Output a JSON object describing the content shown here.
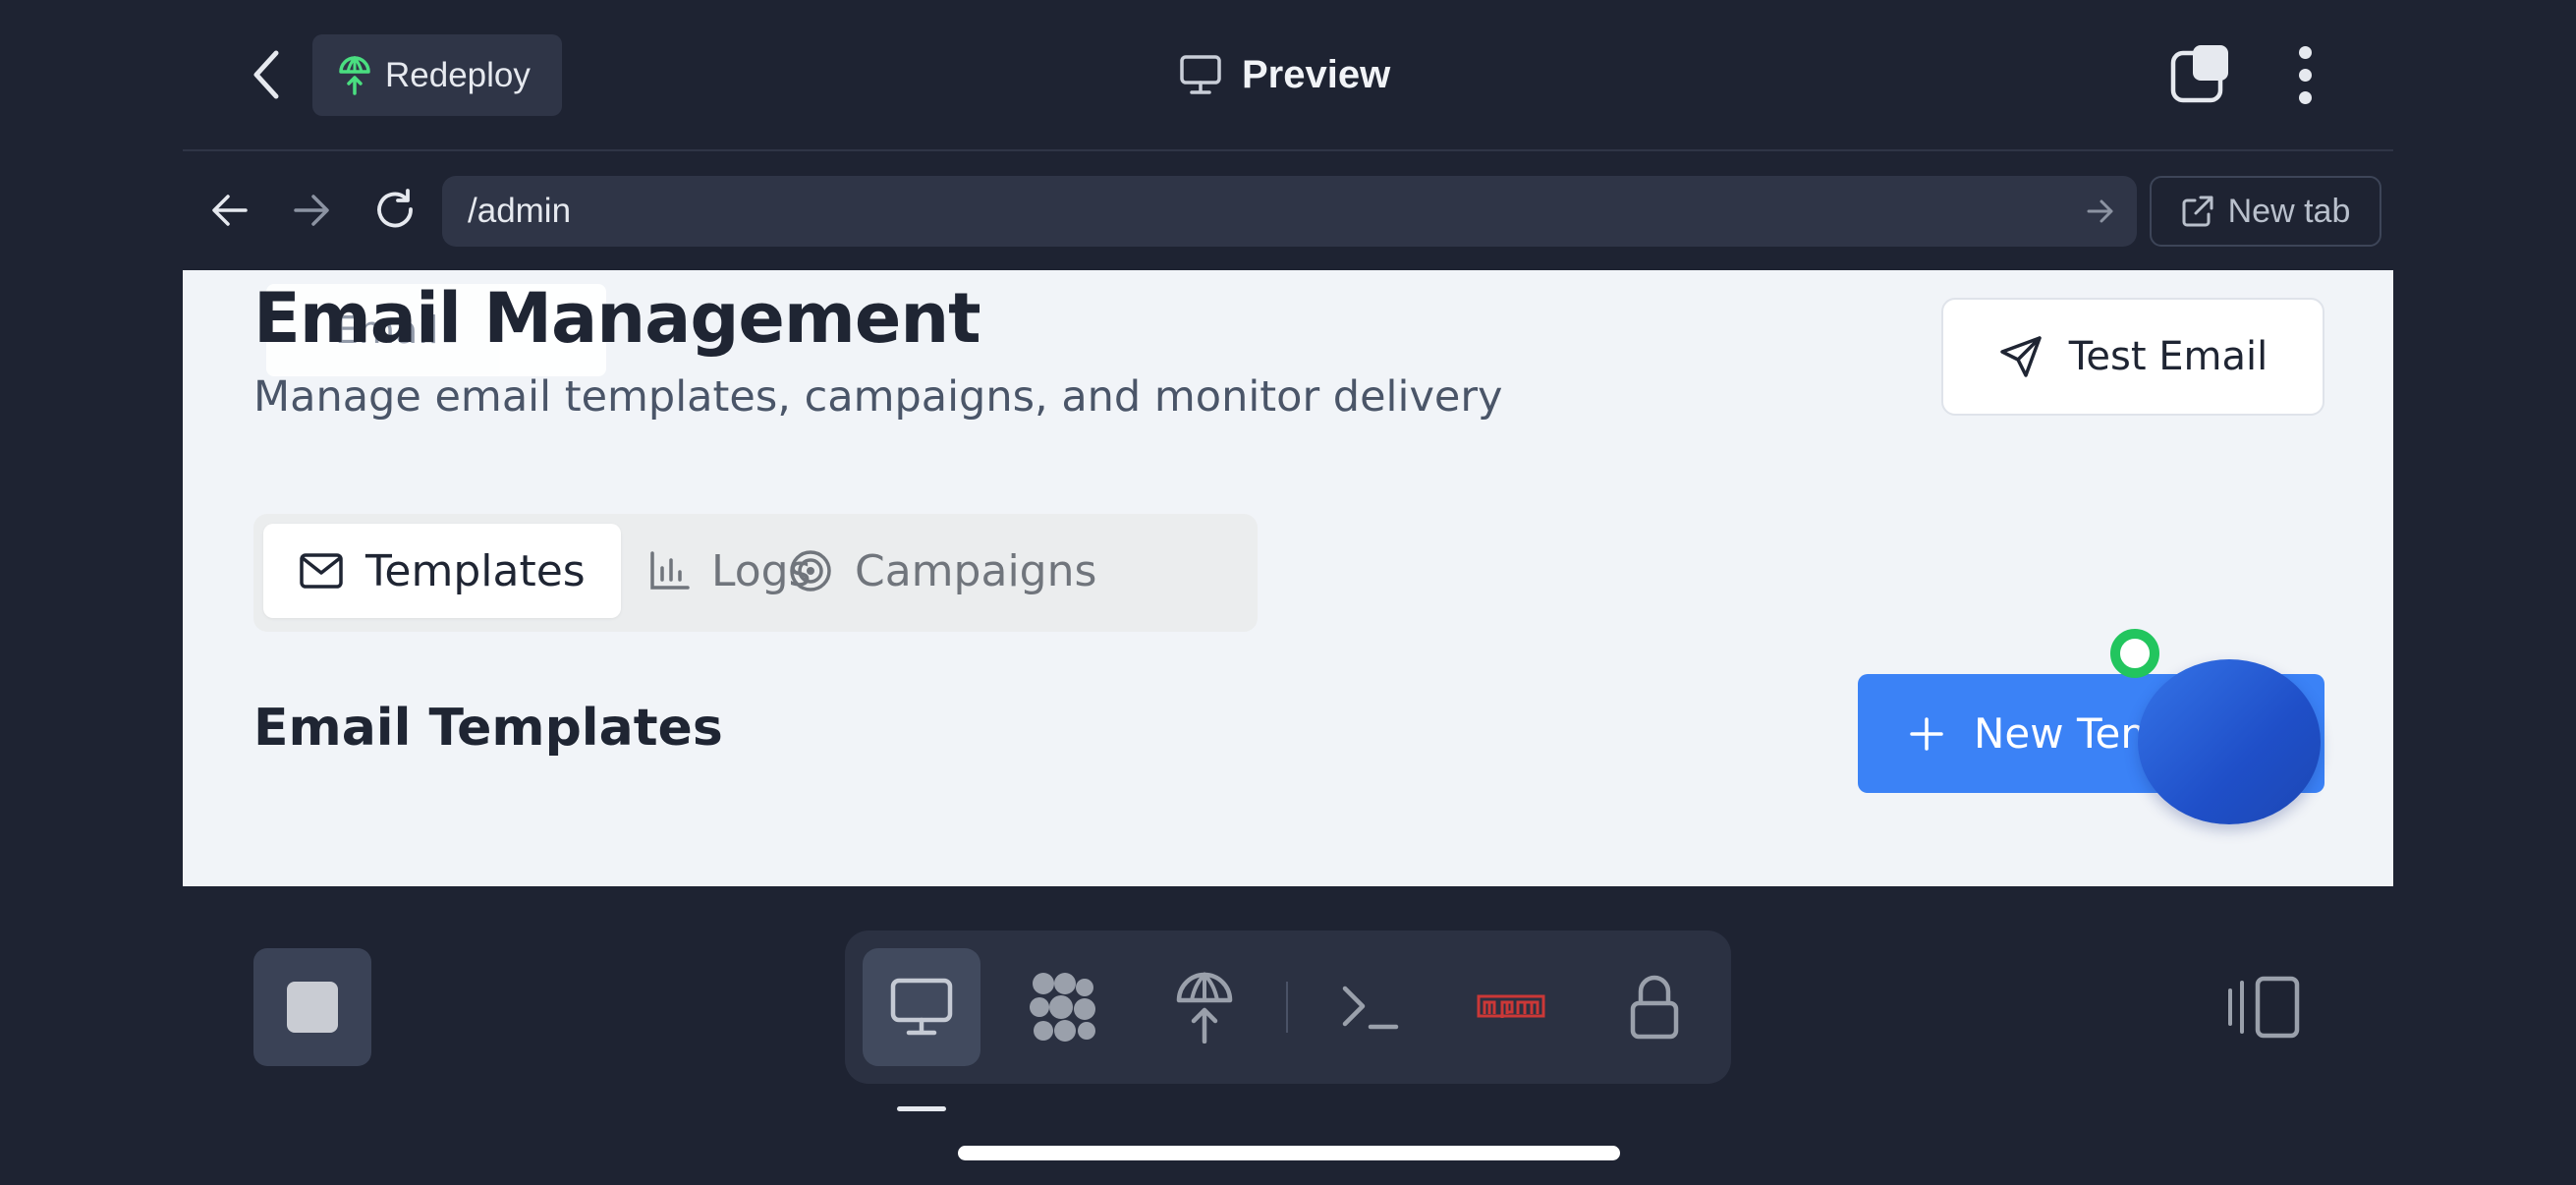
{
  "header": {
    "back_icon": "chevron-left-icon",
    "redeploy_label": "Redeploy",
    "title": "Preview",
    "title_icon": "monitor-icon"
  },
  "browser": {
    "url": "/admin",
    "new_tab_label": "New tab"
  },
  "page": {
    "ghost_chip_text": "Email",
    "heading": "Email Management",
    "subtitle": "Manage email templates, campaigns, and monitor delivery",
    "test_email_label": "Test Email",
    "tabs": [
      {
        "label": "Templates",
        "icon": "mail-icon",
        "active": true
      },
      {
        "label": "Logs",
        "icon": "bar-chart-icon",
        "active": false
      },
      {
        "label": "Campaigns",
        "icon": "target-icon",
        "active": false
      }
    ],
    "section_title": "Email Templates",
    "new_template_label": "New Template"
  },
  "dock": {
    "items": [
      "monitor-icon",
      "cluster-icon",
      "deploy-icon",
      "terminal-icon",
      "npm-icon",
      "lock-icon"
    ],
    "active_index": 0
  },
  "colors": {
    "app_bg": "#1e2332",
    "chip_bg": "#2f3547",
    "accent_blue": "#3b82f6",
    "status_green": "#22c55e",
    "npm_red": "#cb3837",
    "redeploy_green": "#4ade80"
  }
}
